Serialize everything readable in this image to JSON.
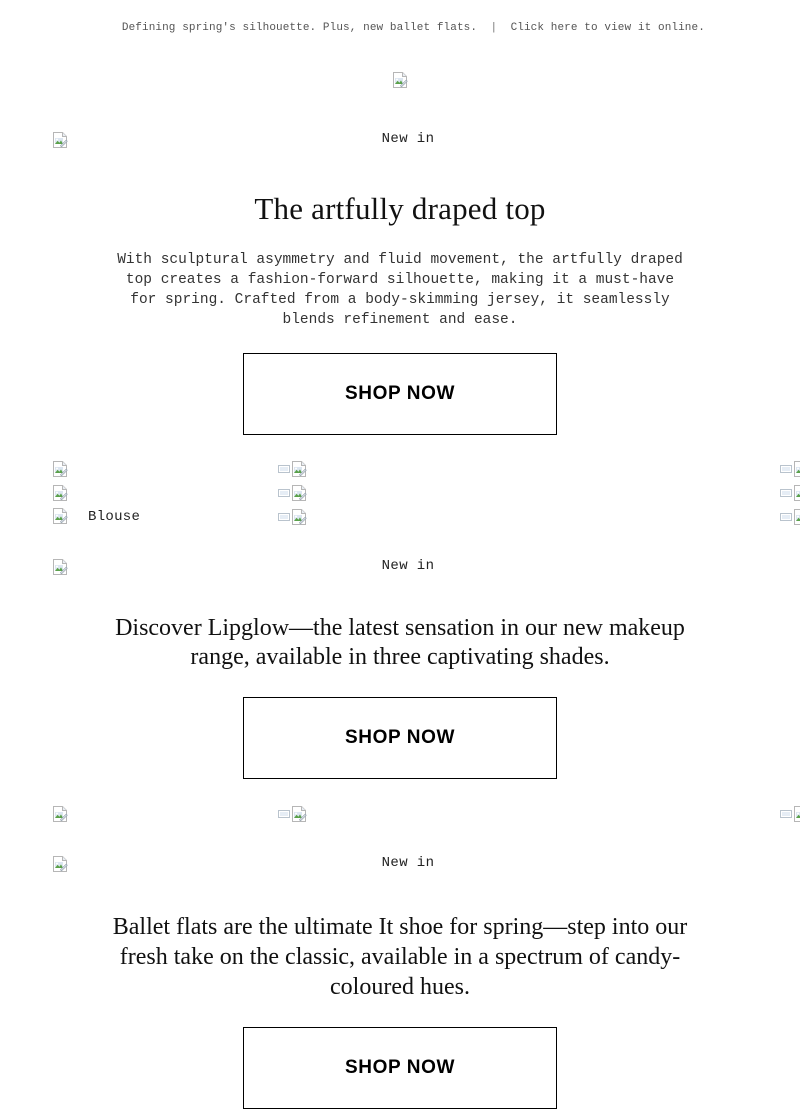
{
  "preheader": {
    "message": "Defining spring's silhouette. Plus, new ballet flats.",
    "separator": "|",
    "online_link": "Click here to view it online."
  },
  "logo": {
    "icon": "broken-image-icon",
    "alt": ""
  },
  "sections": [
    {
      "id": "artfully-draped-top",
      "eyebrow": "New in",
      "eyebrow_icon": "broken-image-icon",
      "headline": "The artfully draped top",
      "body": "With sculptural asymmetry and fluid movement, the artfully draped top creates a fashion-forward silhouette, making it a must-have for spring. Crafted from a body-skimming jersey, it seamlessly blends refinement and ease.",
      "cta_label": "SHOP NOW"
    },
    {
      "id": "lipglow",
      "eyebrow": "New in",
      "eyebrow_icon": "broken-image-icon",
      "headline": "Discover Lipglow—the latest sensation in our new makeup range, available in three captivating shades.",
      "cta_label": "SHOP NOW"
    },
    {
      "id": "ballet-flats",
      "eyebrow": "New in",
      "eyebrow_icon": "broken-image-icon",
      "headline": "Ballet flats are the ultimate It shoe for spring—step into our fresh take on the classic, available in a spectrum of candy-coloured hues.",
      "cta_label": "SHOP NOW"
    }
  ],
  "product_grid_1": {
    "columns": [
      {
        "rows": [
          {
            "type": "image",
            "icon": "broken-image-icon",
            "label": ""
          },
          {
            "type": "image",
            "icon": "broken-image-icon",
            "label": ""
          },
          {
            "type": "image",
            "icon": "broken-image-icon",
            "label": "Blouse"
          }
        ]
      },
      {
        "rows": [
          {
            "type": "image",
            "icon": "broken-image-icon",
            "label": ""
          },
          {
            "type": "image",
            "icon": "broken-image-icon",
            "label": ""
          },
          {
            "type": "image",
            "icon": "broken-image-icon",
            "label": ""
          }
        ]
      },
      {
        "rows": [
          {
            "type": "image",
            "icon": "broken-image-icon",
            "label": ""
          },
          {
            "type": "image",
            "icon": "broken-image-icon",
            "label": ""
          },
          {
            "type": "image",
            "icon": "broken-image-icon",
            "label": ""
          }
        ]
      }
    ]
  },
  "product_grid_2": {
    "columns": [
      {
        "rows": [
          {
            "type": "image",
            "icon": "broken-image-icon",
            "label": ""
          }
        ]
      },
      {
        "rows": [
          {
            "type": "image",
            "icon": "broken-image-icon",
            "label": ""
          }
        ]
      },
      {
        "rows": [
          {
            "type": "image",
            "icon": "broken-image-icon",
            "label": ""
          }
        ]
      }
    ]
  },
  "colors": {
    "background": "#ffffff",
    "text": "#111111",
    "muted_text": "#555555",
    "button_border": "#000000"
  }
}
